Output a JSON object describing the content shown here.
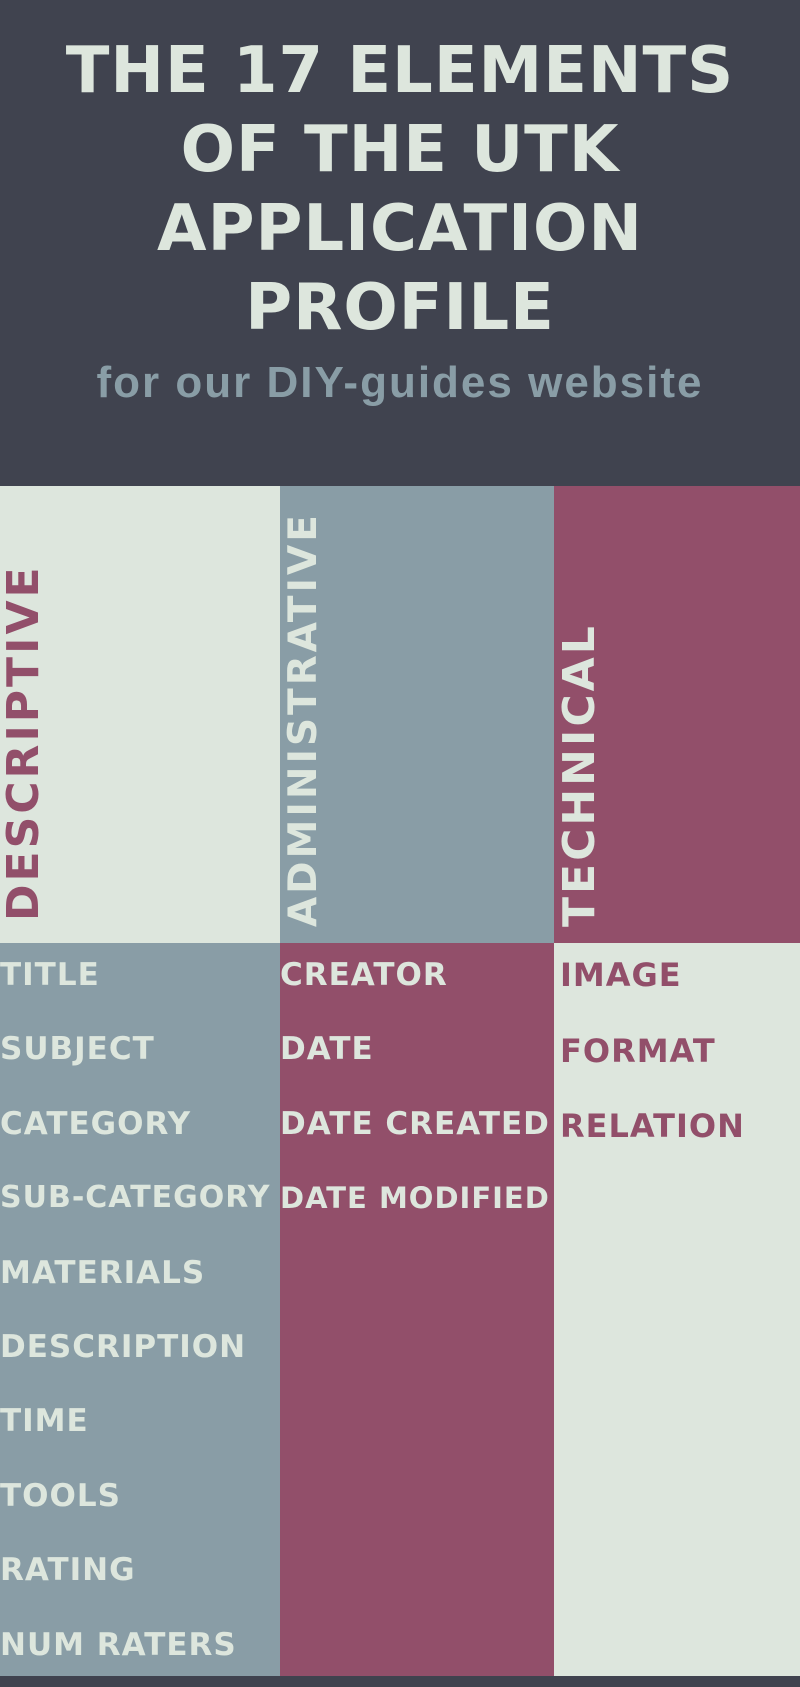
{
  "header": {
    "title": "THE 17 ELEMENTS OF THE UTK APPLICATION PROFILE",
    "subtitle": "for our DIY-guides website"
  },
  "colors": {
    "dark": "#40434f",
    "light": "#dde6dd",
    "slate": "#899da6",
    "wine": "#924f6a"
  },
  "categories": [
    {
      "label": "DESCRIPTIVE",
      "elements": [
        "TITLE",
        "SUBJECT",
        "CATEGORY",
        "SUB-CATEGORY",
        "MATERIALS",
        "DESCRIPTION",
        "TIME",
        "TOOLS",
        "RATING",
        "NUM RATERS"
      ]
    },
    {
      "label": "ADMINISTRATIVE",
      "elements": [
        "CREATOR",
        "DATE",
        "DATE CREATED",
        "DATE MODIFIED"
      ]
    },
    {
      "label": "TECHNICAL",
      "elements": [
        "IMAGE",
        "FORMAT",
        "RELATION"
      ]
    }
  ]
}
